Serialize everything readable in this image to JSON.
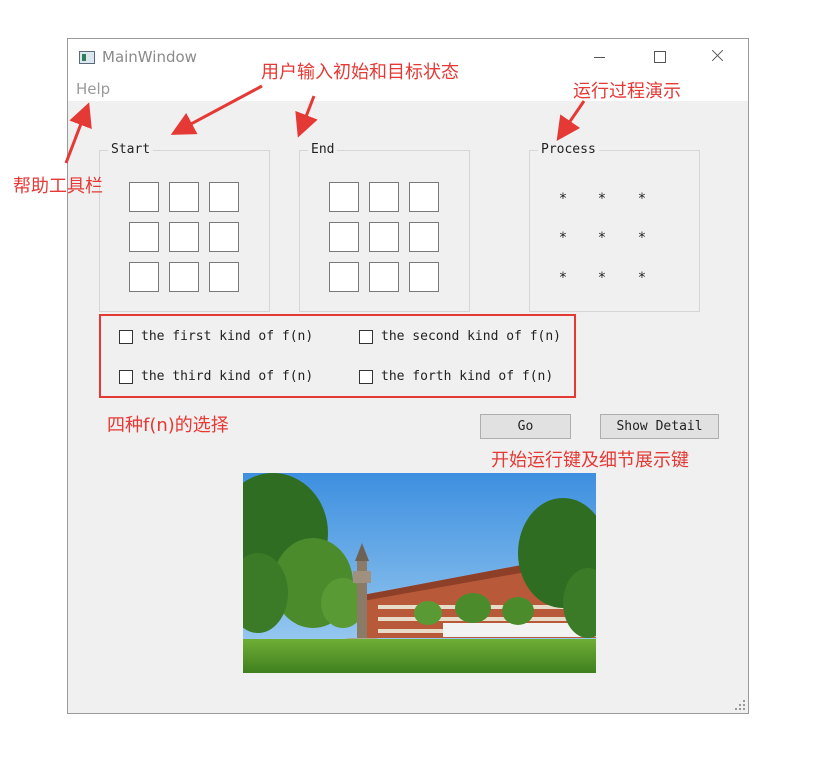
{
  "window": {
    "title": "MainWindow",
    "menu": [
      "Help"
    ]
  },
  "groups": {
    "start": {
      "title": "Start",
      "cells": [
        "",
        "",
        "",
        "",
        "",
        "",
        "",
        "",
        ""
      ]
    },
    "end": {
      "title": "End",
      "cells": [
        "",
        "",
        "",
        "",
        "",
        "",
        "",
        "",
        ""
      ]
    },
    "process": {
      "title": "Process",
      "cells": [
        "*",
        "*",
        "*",
        "*",
        "*",
        "*",
        "*",
        "*",
        "*"
      ]
    }
  },
  "options": [
    {
      "label": "the first kind of f(n)",
      "checked": false
    },
    {
      "label": "the second kind of f(n)",
      "checked": false
    },
    {
      "label": "the third kind of f(n)",
      "checked": false
    },
    {
      "label": "the forth kind of f(n)",
      "checked": false
    }
  ],
  "buttons": {
    "go": "Go",
    "detail": "Show Detail"
  },
  "annotations": {
    "help_toolbar": "帮助工具栏",
    "input_states": "用户输入初始和目标状态",
    "process_demo": "运行过程演示",
    "fn_choice": "四种f(n)的选择",
    "run_detail": "开始运行键及细节展示键"
  },
  "colors": {
    "annotation": "#e53935",
    "window_bg": "#f0f0f0"
  }
}
